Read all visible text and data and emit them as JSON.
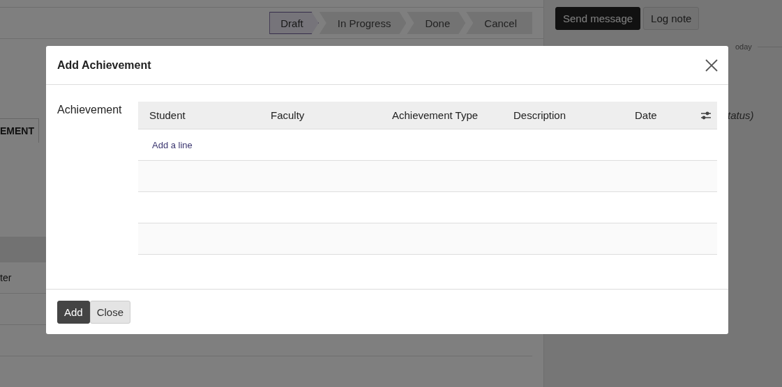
{
  "background": {
    "statusbar": [
      {
        "label": "Draft",
        "selected": true
      },
      {
        "label": "In Progress",
        "selected": false
      },
      {
        "label": "Done",
        "selected": false
      },
      {
        "label": "Cancel",
        "selected": false
      }
    ],
    "chatter_buttons": [
      {
        "label": "Send message",
        "kind": "primary"
      },
      {
        "label": "Log note",
        "kind": "secondary"
      }
    ],
    "tab": "EMENT",
    "table_cell": "ter",
    "date_separator": "oday",
    "message": "tatus)"
  },
  "dialog": {
    "title": "Add Achievement",
    "field_label": "Achievement",
    "columns": [
      "Student",
      "Faculty",
      "Achievement Type",
      "Description",
      "Date"
    ],
    "add_line": "Add a line",
    "empty_rows": [
      {
        "kind": "empty"
      },
      {
        "kind": "empty"
      },
      {
        "kind": "empty"
      }
    ],
    "buttons": [
      {
        "label": "Add",
        "kind": "primary"
      },
      {
        "label": "Close",
        "kind": "secondary"
      }
    ]
  }
}
